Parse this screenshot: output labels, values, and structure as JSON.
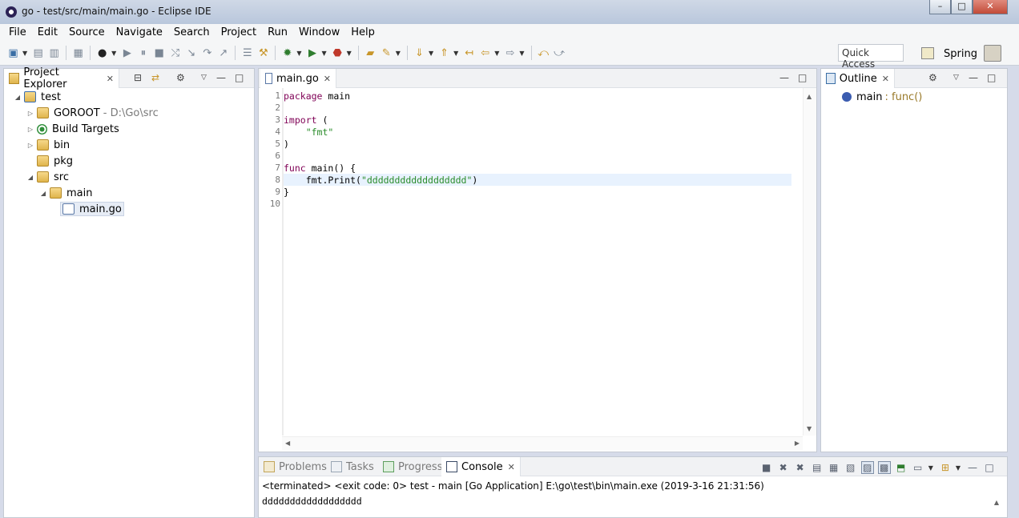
{
  "window": {
    "title": "go - test/src/main/main.go - Eclipse IDE",
    "controls": {
      "minimize": "–",
      "maximize": "□",
      "close": "✕"
    }
  },
  "menu": [
    "File",
    "Edit",
    "Source",
    "Navigate",
    "Search",
    "Project",
    "Run",
    "Window",
    "Help"
  ],
  "toolbar": {
    "quick_access": "Quick Access",
    "perspective": "Spring"
  },
  "project_explorer": {
    "tab_label": "Project Explorer",
    "items": [
      {
        "label": "test",
        "detail": "",
        "icon": "project-icon",
        "twisty": "expanded"
      },
      {
        "label": "GOROOT",
        "detail": "- D:\\Go\\src",
        "icon": "goroot-icon",
        "twisty": "collapsed"
      },
      {
        "label": "Build Targets",
        "detail": "",
        "icon": "build-targets-icon",
        "twisty": "collapsed"
      },
      {
        "label": "bin",
        "detail": "",
        "icon": "bin-folder-icon",
        "twisty": "collapsed"
      },
      {
        "label": "pkg",
        "detail": "",
        "icon": "folder-icon",
        "twisty": "none"
      },
      {
        "label": "src",
        "detail": "",
        "icon": "source-folder-icon",
        "twisty": "expanded"
      },
      {
        "label": "main",
        "detail": "",
        "icon": "package-folder-icon",
        "twisty": "expanded"
      },
      {
        "label": "main.go",
        "detail": "",
        "icon": "go-file-icon",
        "twisty": "none"
      }
    ]
  },
  "editor": {
    "tab_label": "main.go",
    "lines": [
      {
        "no": "1",
        "text": "package main"
      },
      {
        "no": "2",
        "text": ""
      },
      {
        "no": "3",
        "text": "import ("
      },
      {
        "no": "4",
        "text": "    \"fmt\""
      },
      {
        "no": "5",
        "text": ")"
      },
      {
        "no": "6",
        "text": ""
      },
      {
        "no": "7",
        "text": "func main() {"
      },
      {
        "no": "8",
        "text": "    fmt.Print(\"dddddddddddddddddd\")"
      },
      {
        "no": "9",
        "text": "}"
      },
      {
        "no": "10",
        "text": ""
      }
    ]
  },
  "outline": {
    "tab_label": "Outline",
    "item_name": "main",
    "item_type": ": func()"
  },
  "bottom_tabs": {
    "problems": "Problems",
    "tasks": "Tasks",
    "progress": "Progress",
    "console": "Console"
  },
  "console": {
    "status": "<terminated> <exit code: 0> test - main [Go Application] E:\\go\\test\\bin\\main.exe (2019-3-16 21:31:56)",
    "output": "dddddddddddddddddd"
  }
}
